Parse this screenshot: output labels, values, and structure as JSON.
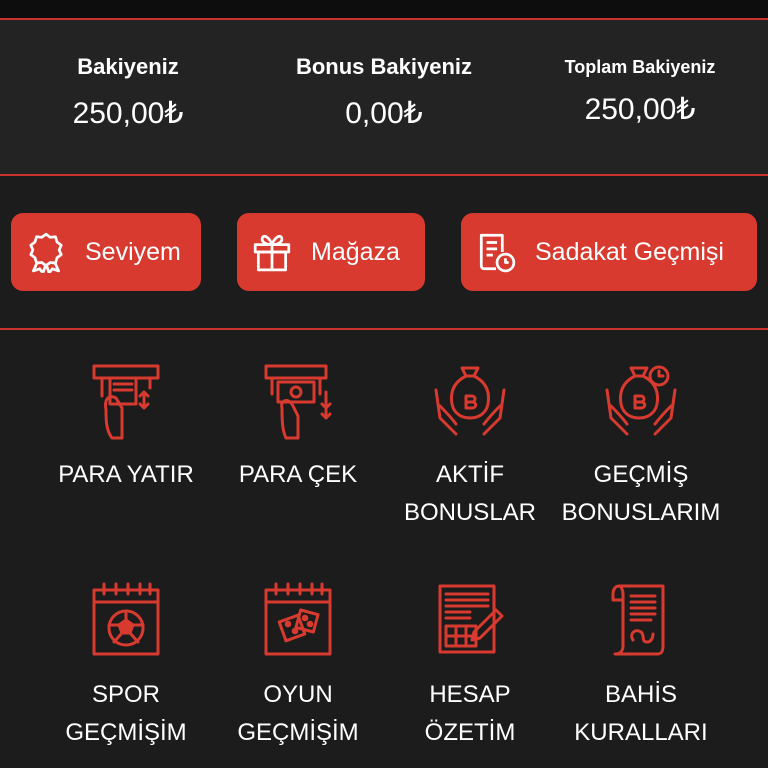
{
  "balances": [
    {
      "label": "Bakiyeniz",
      "value": "250,00₺"
    },
    {
      "label": "Bonus Bakiyeniz",
      "value": "0,00₺"
    },
    {
      "label": "Toplam Bakiyeniz",
      "value": "250,00₺"
    }
  ],
  "buttons": [
    {
      "label": "Seviyem",
      "icon": "badge-icon"
    },
    {
      "label": "Mağaza",
      "icon": "gift-icon"
    },
    {
      "label": "Sadakat Geçmişi",
      "icon": "document-clock-icon"
    }
  ],
  "menu": [
    {
      "line1": "PARA YATIR",
      "line2": "",
      "icon": "deposit-icon"
    },
    {
      "line1": "PARA ÇEK",
      "line2": "",
      "icon": "withdraw-icon"
    },
    {
      "line1": "AKTİF",
      "line2": "BONUSLAR",
      "icon": "money-bag-hands-icon"
    },
    {
      "line1": "GEÇMİŞ",
      "line2": "BONUSLARIM",
      "icon": "money-bag-history-icon"
    },
    {
      "line1": "SPOR",
      "line2": "GEÇMİŞİM",
      "icon": "calendar-soccer-icon"
    },
    {
      "line1": "OYUN",
      "line2": "GEÇMİŞİM",
      "icon": "calendar-dice-icon"
    },
    {
      "line1": "HESAP",
      "line2": "ÖZETİM",
      "icon": "account-summary-icon"
    },
    {
      "line1": "BAHİS",
      "line2": "KURALLARI",
      "icon": "rules-document-icon"
    }
  ],
  "colors": {
    "accent": "#d93a30",
    "background": "#1c1c1c",
    "panel": "#232323",
    "divider": "#c8342b"
  }
}
